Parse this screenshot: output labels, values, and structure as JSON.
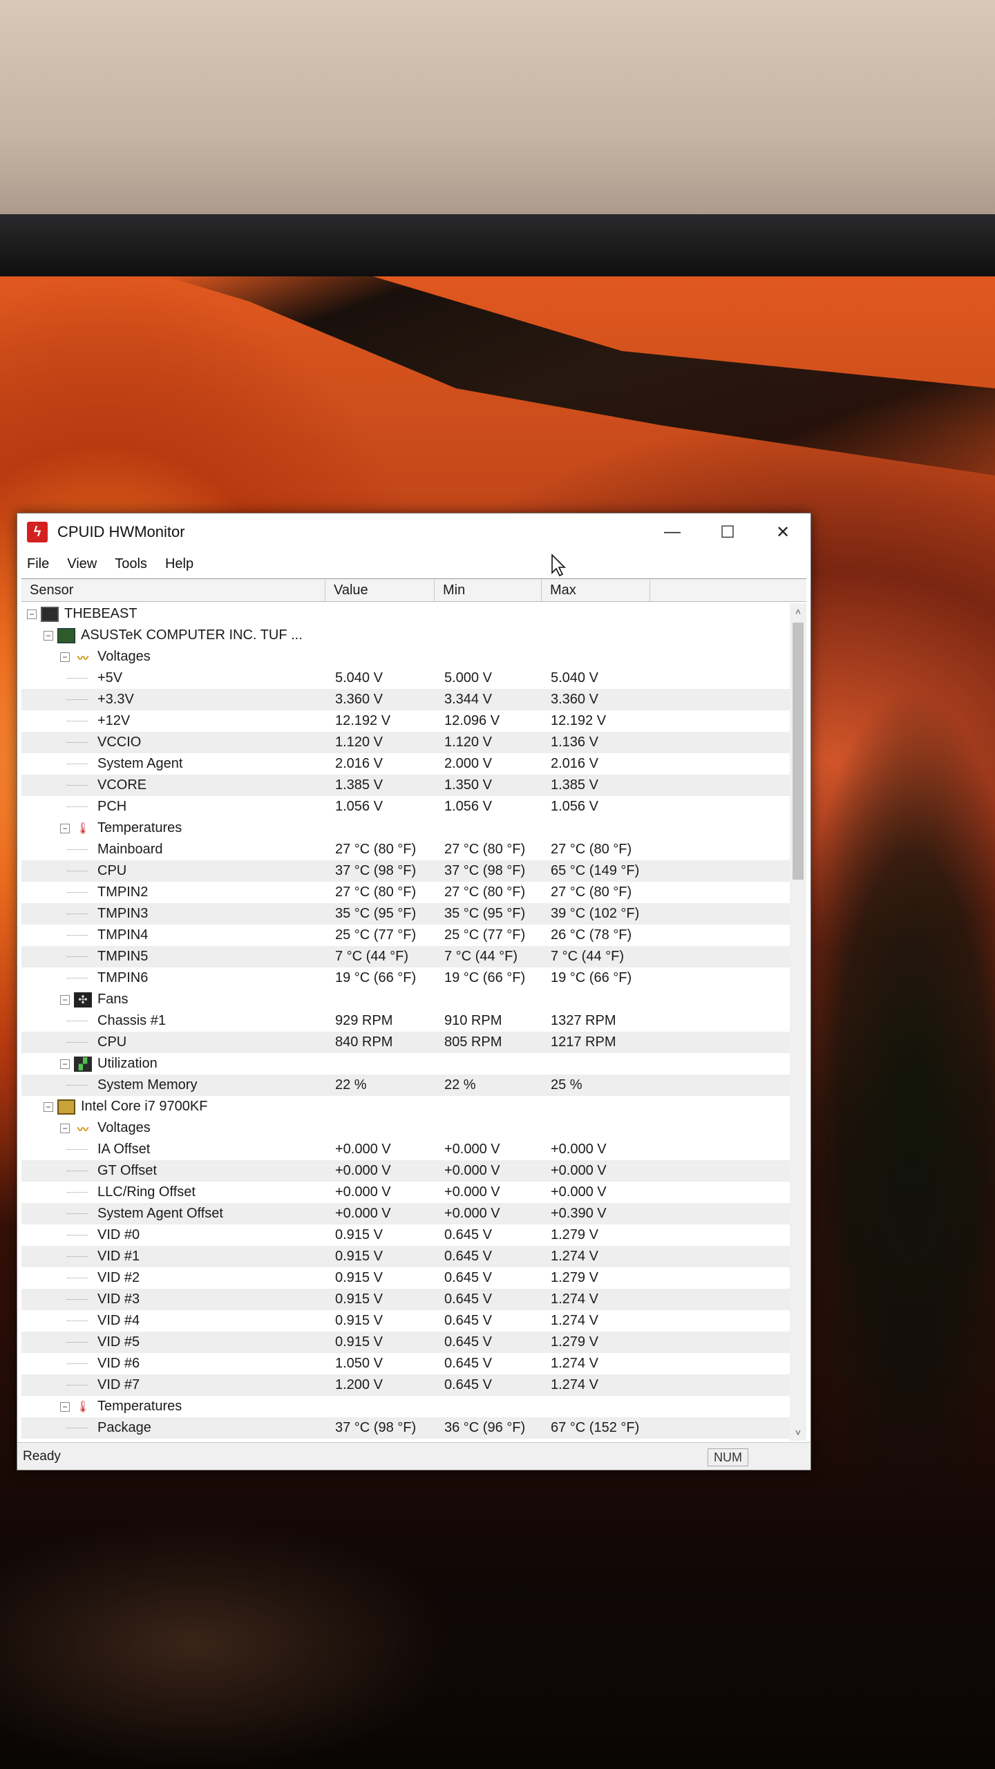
{
  "window": {
    "title": "CPUID HWMonitor",
    "minimize": "—",
    "maximize": "☐",
    "close": "✕"
  },
  "menu": [
    "File",
    "View",
    "Tools",
    "Help"
  ],
  "columns": {
    "sensor": "Sensor",
    "value": "Value",
    "min": "Min",
    "max": "Max"
  },
  "tree": [
    {
      "level": 0,
      "type": "root",
      "icon": "computer-icon",
      "label": "THEBEAST"
    },
    {
      "level": 1,
      "type": "device",
      "icon": "motherboard-icon",
      "label": "ASUSTeK COMPUTER INC. TUF ..."
    },
    {
      "level": 2,
      "type": "group",
      "icon": "voltage-icon",
      "label": "Voltages"
    },
    {
      "level": 3,
      "type": "sensor",
      "label": "+5V",
      "value": "5.040 V",
      "min": "5.000 V",
      "max": "5.040 V"
    },
    {
      "level": 3,
      "type": "sensor",
      "label": "+3.3V",
      "value": "3.360 V",
      "min": "3.344 V",
      "max": "3.360 V"
    },
    {
      "level": 3,
      "type": "sensor",
      "label": "+12V",
      "value": "12.192 V",
      "min": "12.096 V",
      "max": "12.192 V"
    },
    {
      "level": 3,
      "type": "sensor",
      "label": "VCCIO",
      "value": "1.120 V",
      "min": "1.120 V",
      "max": "1.136 V"
    },
    {
      "level": 3,
      "type": "sensor",
      "label": "System Agent",
      "value": "2.016 V",
      "min": "2.000 V",
      "max": "2.016 V"
    },
    {
      "level": 3,
      "type": "sensor",
      "label": "VCORE",
      "value": "1.385 V",
      "min": "1.350 V",
      "max": "1.385 V"
    },
    {
      "level": 3,
      "type": "sensor",
      "label": "PCH",
      "value": "1.056 V",
      "min": "1.056 V",
      "max": "1.056 V"
    },
    {
      "level": 2,
      "type": "group",
      "icon": "thermometer-icon",
      "label": "Temperatures"
    },
    {
      "level": 3,
      "type": "sensor",
      "label": "Mainboard",
      "value": "27 °C  (80 °F)",
      "min": "27 °C  (80 °F)",
      "max": "27 °C  (80 °F)"
    },
    {
      "level": 3,
      "type": "sensor",
      "label": "CPU",
      "value": "37 °C  (98 °F)",
      "min": "37 °C  (98 °F)",
      "max": "65 °C  (149 °F)"
    },
    {
      "level": 3,
      "type": "sensor",
      "label": "TMPIN2",
      "value": "27 °C  (80 °F)",
      "min": "27 °C  (80 °F)",
      "max": "27 °C  (80 °F)"
    },
    {
      "level": 3,
      "type": "sensor",
      "label": "TMPIN3",
      "value": "35 °C  (95 °F)",
      "min": "35 °C  (95 °F)",
      "max": "39 °C  (102 °F)"
    },
    {
      "level": 3,
      "type": "sensor",
      "label": "TMPIN4",
      "value": "25 °C  (77 °F)",
      "min": "25 °C  (77 °F)",
      "max": "26 °C  (78 °F)"
    },
    {
      "level": 3,
      "type": "sensor",
      "label": "TMPIN5",
      "value": "7 °C  (44 °F)",
      "min": "7 °C  (44 °F)",
      "max": "7 °C  (44 °F)"
    },
    {
      "level": 3,
      "type": "sensor",
      "label": "TMPIN6",
      "value": "19 °C  (66 °F)",
      "min": "19 °C  (66 °F)",
      "max": "19 °C  (66 °F)"
    },
    {
      "level": 2,
      "type": "group",
      "icon": "fan-icon",
      "label": "Fans"
    },
    {
      "level": 3,
      "type": "sensor",
      "label": "Chassis #1",
      "value": "929 RPM",
      "min": "910 RPM",
      "max": "1327 RPM"
    },
    {
      "level": 3,
      "type": "sensor",
      "label": "CPU",
      "value": "840 RPM",
      "min": "805 RPM",
      "max": "1217 RPM"
    },
    {
      "level": 2,
      "type": "group",
      "icon": "utilization-icon",
      "label": "Utilization"
    },
    {
      "level": 3,
      "type": "sensor",
      "label": "System Memory",
      "value": "22 %",
      "min": "22 %",
      "max": "25 %"
    },
    {
      "level": 1,
      "type": "device",
      "icon": "cpu-chip-icon",
      "label": "Intel Core i7 9700KF"
    },
    {
      "level": 2,
      "type": "group",
      "icon": "voltage-icon",
      "label": "Voltages"
    },
    {
      "level": 3,
      "type": "sensor",
      "label": "IA Offset",
      "value": "+0.000 V",
      "min": "+0.000 V",
      "max": "+0.000 V"
    },
    {
      "level": 3,
      "type": "sensor",
      "label": "GT Offset",
      "value": "+0.000 V",
      "min": "+0.000 V",
      "max": "+0.000 V"
    },
    {
      "level": 3,
      "type": "sensor",
      "label": "LLC/Ring Offset",
      "value": "+0.000 V",
      "min": "+0.000 V",
      "max": "+0.000 V"
    },
    {
      "level": 3,
      "type": "sensor",
      "label": "System Agent Offset",
      "value": "+0.000 V",
      "min": "+0.000 V",
      "max": "+0.390 V"
    },
    {
      "level": 3,
      "type": "sensor",
      "label": "VID #0",
      "value": "0.915 V",
      "min": "0.645 V",
      "max": "1.279 V"
    },
    {
      "level": 3,
      "type": "sensor",
      "label": "VID #1",
      "value": "0.915 V",
      "min": "0.645 V",
      "max": "1.274 V"
    },
    {
      "level": 3,
      "type": "sensor",
      "label": "VID #2",
      "value": "0.915 V",
      "min": "0.645 V",
      "max": "1.279 V"
    },
    {
      "level": 3,
      "type": "sensor",
      "label": "VID #3",
      "value": "0.915 V",
      "min": "0.645 V",
      "max": "1.274 V"
    },
    {
      "level": 3,
      "type": "sensor",
      "label": "VID #4",
      "value": "0.915 V",
      "min": "0.645 V",
      "max": "1.274 V"
    },
    {
      "level": 3,
      "type": "sensor",
      "label": "VID #5",
      "value": "0.915 V",
      "min": "0.645 V",
      "max": "1.279 V"
    },
    {
      "level": 3,
      "type": "sensor",
      "label": "VID #6",
      "value": "1.050 V",
      "min": "0.645 V",
      "max": "1.274 V"
    },
    {
      "level": 3,
      "type": "sensor",
      "label": "VID #7",
      "value": "1.200 V",
      "min": "0.645 V",
      "max": "1.274 V"
    },
    {
      "level": 2,
      "type": "group",
      "icon": "thermometer-icon",
      "label": "Temperatures"
    },
    {
      "level": 3,
      "type": "sensor",
      "label": "Package",
      "value": "37 °C  (98 °F)",
      "min": "36 °C  (96 °F)",
      "max": "67 °C  (152 °F)"
    }
  ],
  "status": {
    "text": "Ready",
    "num": "NUM"
  },
  "scrollbar": {
    "up": "˄",
    "down": "˅"
  }
}
